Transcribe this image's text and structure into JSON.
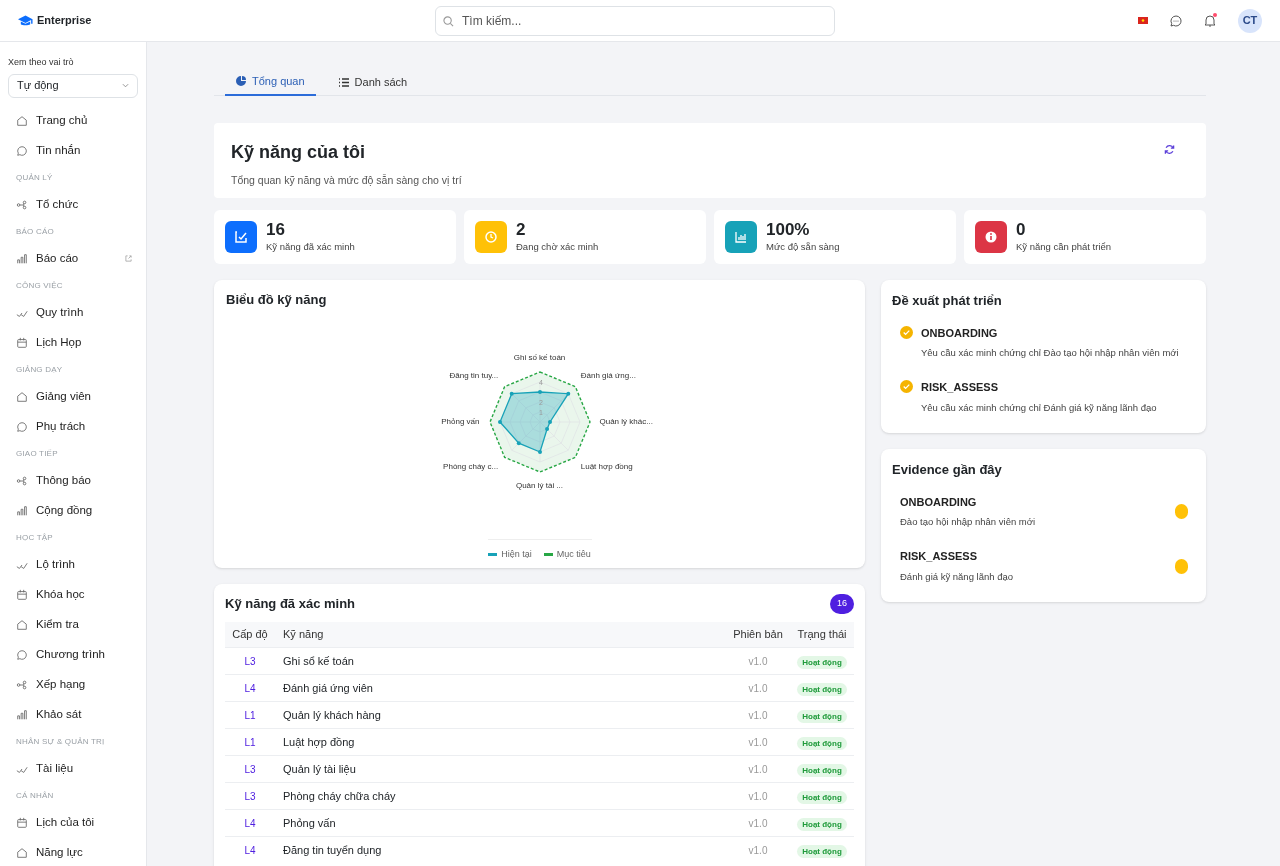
{
  "brand": "Enterprise",
  "search": {
    "placeholder": "Tìm kiếm..."
  },
  "header": {
    "avatar": "CT",
    "notification_dot": true
  },
  "sidebar": {
    "role_label": "Xem theo vai trò",
    "role_value": "Tự động",
    "items": [
      {
        "kind": "item",
        "label": "Trang chủ",
        "external": false
      },
      {
        "kind": "item",
        "label": "Tin nhắn",
        "external": false
      },
      {
        "kind": "section",
        "label": "QUẢN LÝ"
      },
      {
        "kind": "item",
        "label": "Tổ chức",
        "external": false
      },
      {
        "kind": "section",
        "label": "BÁO CÁO"
      },
      {
        "kind": "item",
        "label": "Báo cáo",
        "external": true
      },
      {
        "kind": "section",
        "label": "CÔNG VIỆC"
      },
      {
        "kind": "item",
        "label": "Quy trình",
        "external": false
      },
      {
        "kind": "item",
        "label": "Lịch Họp",
        "external": false
      },
      {
        "kind": "section",
        "label": "GIẢNG DẠY"
      },
      {
        "kind": "item",
        "label": "Giảng viên",
        "external": false
      },
      {
        "kind": "item",
        "label": "Phụ trách",
        "external": false
      },
      {
        "kind": "section",
        "label": "GIAO TIẾP"
      },
      {
        "kind": "item",
        "label": "Thông báo",
        "external": false
      },
      {
        "kind": "item",
        "label": "Cộng đồng",
        "external": false
      },
      {
        "kind": "section",
        "label": "HỌC TẬP"
      },
      {
        "kind": "item",
        "label": "Lộ trình",
        "external": false
      },
      {
        "kind": "item",
        "label": "Khóa học",
        "external": false
      },
      {
        "kind": "item",
        "label": "Kiểm tra",
        "external": false
      },
      {
        "kind": "item",
        "label": "Chương trình",
        "external": false
      },
      {
        "kind": "item",
        "label": "Xếp hạng",
        "external": false
      },
      {
        "kind": "item",
        "label": "Khảo sát",
        "external": false
      },
      {
        "kind": "section",
        "label": "NHÂN SỰ & QUẢN TRỊ"
      },
      {
        "kind": "item",
        "label": "Tài liệu",
        "external": false
      },
      {
        "kind": "section",
        "label": "CÁ NHÂN"
      },
      {
        "kind": "item",
        "label": "Lịch của tôi",
        "external": false
      },
      {
        "kind": "item",
        "label": "Năng lực",
        "external": false
      }
    ]
  },
  "tabs": [
    {
      "label": "Tổng quan",
      "selected": true
    },
    {
      "label": "Danh sách",
      "selected": false
    }
  ],
  "page": {
    "title": "Kỹ năng của tôi",
    "subtitle": "Tổng quan kỹ năng và mức độ sẵn sàng cho vị trí"
  },
  "stats": [
    {
      "value": "16",
      "label": "Kỹ năng đã xác minh",
      "color": "#0d6efd"
    },
    {
      "value": "2",
      "label": "Đang chờ xác minh",
      "color": "#ffc107"
    },
    {
      "value": "100%",
      "label": "Mức độ sẵn sàng",
      "color": "#17a2b8"
    },
    {
      "value": "0",
      "label": "Kỹ năng cần phát triển",
      "color": "#dc3545"
    }
  ],
  "radar": {
    "title": "Biểu đồ kỹ năng",
    "ticks": [
      "4",
      "2",
      "1"
    ],
    "axes": [
      "Ghi số kế toán",
      "Đăng tin tuy...",
      "Đánh giá ứng...",
      "Phỏng vấn",
      "Quản lý khác...",
      "Phòng cháy c...",
      "Luật hợp đồng",
      "Quản lý tài ..."
    ],
    "legend": [
      {
        "label": "Hiện tại",
        "color": "#17a2b8"
      },
      {
        "label": "Mục tiêu",
        "color": "#28a745"
      }
    ]
  },
  "verified": {
    "title": "Kỹ năng đã xác minh",
    "count": "16",
    "columns": [
      "Cấp độ",
      "Kỹ năng",
      "Phiên bản",
      "Trạng thái"
    ],
    "rows": [
      {
        "level": "L3",
        "skill": "Ghi sổ kế toán",
        "version": "v1.0",
        "status": "Hoạt động"
      },
      {
        "level": "L4",
        "skill": "Đánh giá ứng viên",
        "version": "v1.0",
        "status": "Hoạt động"
      },
      {
        "level": "L1",
        "skill": "Quản lý khách hàng",
        "version": "v1.0",
        "status": "Hoạt động"
      },
      {
        "level": "L1",
        "skill": "Luật hợp đồng",
        "version": "v1.0",
        "status": "Hoạt động"
      },
      {
        "level": "L3",
        "skill": "Quản lý tài liệu",
        "version": "v1.0",
        "status": "Hoạt động"
      },
      {
        "level": "L3",
        "skill": "Phòng cháy chữa cháy",
        "version": "v1.0",
        "status": "Hoạt động"
      },
      {
        "level": "L4",
        "skill": "Phỏng vấn",
        "version": "v1.0",
        "status": "Hoạt động"
      },
      {
        "level": "L4",
        "skill": "Đăng tin tuyển dụng",
        "version": "v1.0",
        "status": "Hoạt động"
      }
    ]
  },
  "suggestions": {
    "title": "Đề xuất phát triển",
    "items": [
      {
        "code": "ONBOARDING",
        "text": "Yêu cầu xác minh chứng chỉ Đào tạo hội nhập nhân viên mới"
      },
      {
        "code": "RISK_ASSESS",
        "text": "Yêu cầu xác minh chứng chỉ Đánh giá kỹ năng lãnh đạo"
      }
    ]
  },
  "evidence": {
    "title": "Evidence gần đây",
    "items": [
      {
        "code": "ONBOARDING",
        "text": "Đào tạo hội nhập nhân viên mới",
        "color": "#ffc107"
      },
      {
        "code": "RISK_ASSESS",
        "text": "Đánh giá kỹ năng lãnh đạo",
        "color": "#ffc107"
      }
    ]
  }
}
